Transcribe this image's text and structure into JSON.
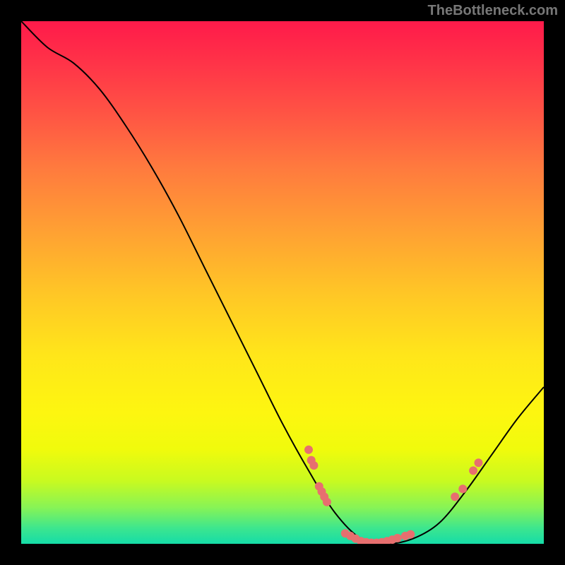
{
  "attribution": "TheBottleneck.com",
  "chart_data": {
    "type": "line",
    "title": "",
    "xlabel": "",
    "ylabel": "",
    "xlim": [
      0,
      100
    ],
    "ylim": [
      0,
      100
    ],
    "curve": [
      {
        "x": 0,
        "y": 100
      },
      {
        "x": 5,
        "y": 95
      },
      {
        "x": 10,
        "y": 92
      },
      {
        "x": 15,
        "y": 87
      },
      {
        "x": 20,
        "y": 80
      },
      {
        "x": 25,
        "y": 72
      },
      {
        "x": 30,
        "y": 63
      },
      {
        "x": 35,
        "y": 53
      },
      {
        "x": 40,
        "y": 43
      },
      {
        "x": 45,
        "y": 33
      },
      {
        "x": 50,
        "y": 23
      },
      {
        "x": 55,
        "y": 14
      },
      {
        "x": 60,
        "y": 6
      },
      {
        "x": 65,
        "y": 1
      },
      {
        "x": 70,
        "y": 0
      },
      {
        "x": 75,
        "y": 1
      },
      {
        "x": 80,
        "y": 4
      },
      {
        "x": 85,
        "y": 10
      },
      {
        "x": 90,
        "y": 17
      },
      {
        "x": 95,
        "y": 24
      },
      {
        "x": 100,
        "y": 30
      }
    ],
    "markers": [
      {
        "x": 55,
        "y": 18
      },
      {
        "x": 55.5,
        "y": 16
      },
      {
        "x": 56,
        "y": 15
      },
      {
        "x": 57,
        "y": 11
      },
      {
        "x": 57.5,
        "y": 10
      },
      {
        "x": 58,
        "y": 9
      },
      {
        "x": 58.5,
        "y": 8
      },
      {
        "x": 62,
        "y": 2
      },
      {
        "x": 63,
        "y": 1.5
      },
      {
        "x": 64,
        "y": 1
      },
      {
        "x": 65,
        "y": 0.5
      },
      {
        "x": 66,
        "y": 0.3
      },
      {
        "x": 67,
        "y": 0.2
      },
      {
        "x": 68,
        "y": 0.2
      },
      {
        "x": 69,
        "y": 0.3
      },
      {
        "x": 70,
        "y": 0.5
      },
      {
        "x": 71,
        "y": 0.8
      },
      {
        "x": 72,
        "y": 1.1
      },
      {
        "x": 73.5,
        "y": 1.5
      },
      {
        "x": 74.5,
        "y": 1.8
      },
      {
        "x": 83,
        "y": 9
      },
      {
        "x": 84.5,
        "y": 10.5
      },
      {
        "x": 86.5,
        "y": 14
      },
      {
        "x": 87.5,
        "y": 15.5
      }
    ],
    "marker_color": "#e76f6f",
    "curve_color": "#000000"
  }
}
